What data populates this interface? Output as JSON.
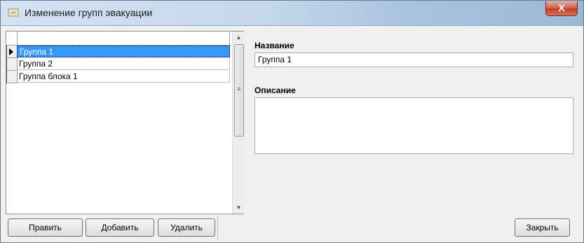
{
  "window": {
    "title": "Изменение групп эвакуации",
    "close_label": "X"
  },
  "grid": {
    "rows": [
      {
        "label": "Группа 1",
        "selected": true
      },
      {
        "label": "Группа 2",
        "selected": false
      },
      {
        "label": "Группа блока 1",
        "selected": false
      }
    ]
  },
  "details": {
    "name_label": "Название",
    "name_value": "Группа 1",
    "description_label": "Описание",
    "description_value": ""
  },
  "buttons": {
    "edit": "Править",
    "add": "Добавить",
    "delete": "Удалить",
    "close": "Закрыть"
  }
}
